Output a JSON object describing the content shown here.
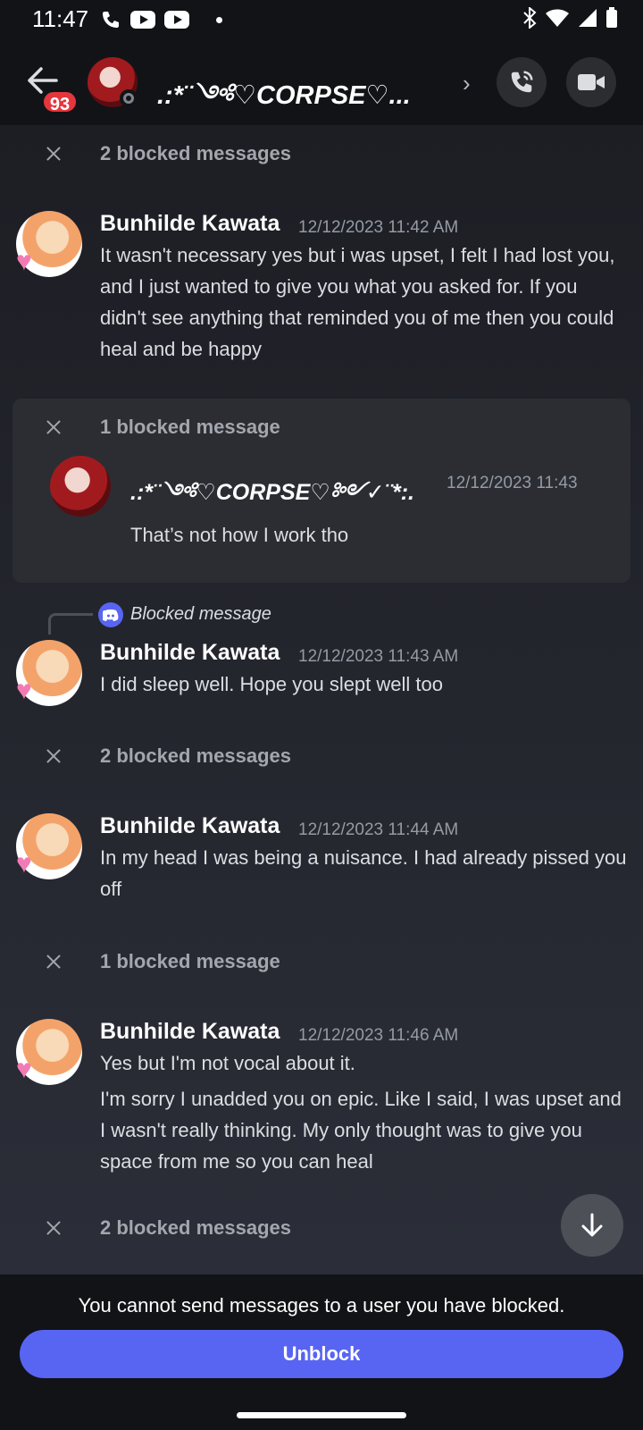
{
  "status_bar": {
    "time": "11:47",
    "icons": [
      "phone-icon",
      "youtube-icon",
      "youtube-icon",
      "notification-dot",
      "bluetooth-icon",
      "wifi-icon",
      "signal-icon",
      "battery-icon"
    ]
  },
  "header": {
    "badge_count": "93",
    "channel_name": ".:*¨༺♡CORPSE♡...",
    "icons": [
      "back-arrow-icon",
      "phone-call-icon",
      "video-camera-icon"
    ]
  },
  "messages": {
    "blocked_1": "2 blocked messages",
    "m1": {
      "author": "Bunhilde Kawata",
      "timestamp": "12/12/2023 11:42 AM",
      "text": "It wasn't necessary yes but i was upset, I felt I had lost you, and I just wanted to give you what you asked for. If you didn't see anything that reminded you of me then you could heal and be happy"
    },
    "blocked_card": {
      "label": "1 blocked message",
      "author": ".:*¨༺♡CORPSE♡༻✓¨*:.",
      "timestamp": "12/12/2023 11:43",
      "text": "That’s not how I work tho"
    },
    "reply_label": "Blocked message",
    "m2": {
      "author": "Bunhilde Kawata",
      "timestamp": "12/12/2023 11:43 AM",
      "text": "I did sleep well. Hope you slept well too"
    },
    "blocked_2": "2 blocked messages",
    "m3": {
      "author": "Bunhilde Kawata",
      "timestamp": "12/12/2023 11:44 AM",
      "text": "In my head I was being a nuisance. I had already pissed you off"
    },
    "blocked_3": "1 blocked message",
    "m4": {
      "author": "Bunhilde Kawata",
      "timestamp": "12/12/2023 11:46 AM",
      "text1": "Yes but I'm not vocal about it.",
      "text2": "I'm sorry I unadded you on epic. Like I said, I was upset and I wasn't really thinking. My only thought was to give you space from me so you can heal"
    },
    "blocked_4": "2 blocked messages"
  },
  "footer": {
    "notice": "You cannot send messages to a user you have blocked.",
    "unblock_label": "Unblock"
  },
  "colors": {
    "accent": "#5865f2",
    "badge": "#e5363e",
    "background": "#1b1c22"
  }
}
